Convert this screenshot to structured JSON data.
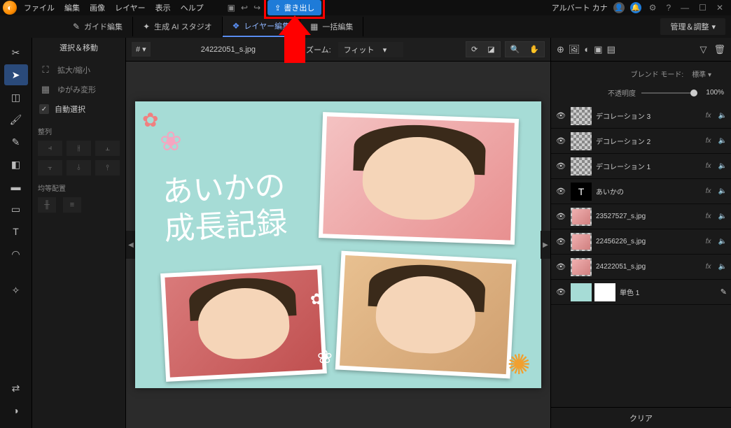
{
  "menu": {
    "file": "ファイル",
    "edit": "編集",
    "image": "画像",
    "layer": "レイヤー",
    "view": "表示",
    "help": "ヘルプ"
  },
  "toolbar": {
    "export": "書き出し",
    "user": "アルバート カナ"
  },
  "modes": {
    "guide": "ガイド編集",
    "ai": "生成 AI スタジオ",
    "layer": "レイヤー編集",
    "batch": "一括編集",
    "manage": "管理＆調整"
  },
  "options": {
    "title": "選択＆移動",
    "scale": "拡大/縮小",
    "warp": "ゆがみ変形",
    "autoselect": "自動選択",
    "align": "整列",
    "distribute": "均等配置"
  },
  "canvas": {
    "filename": "24222051_s.jpg",
    "zoom_label": "ズーム:",
    "zoom_value": "フィット",
    "text_line1": "あいかの",
    "text_line2": "成長記録"
  },
  "layerpanel": {
    "blend_label": "ブレンド モード:",
    "blend_value": "標準",
    "opacity_label": "不透明度",
    "opacity_value": "100%",
    "clear": "クリア",
    "fx": "fx"
  },
  "layers": [
    {
      "name": "デコレーション 3",
      "thumb": "checker",
      "fx": true
    },
    {
      "name": "デコレーション 2",
      "thumb": "checker",
      "fx": true
    },
    {
      "name": "デコレーション 1",
      "thumb": "checker",
      "fx": true
    },
    {
      "name": "あいかの",
      "thumb": "text",
      "fx": true
    },
    {
      "name": "23527527_s.jpg",
      "thumb": "photo",
      "fx": true
    },
    {
      "name": "22456226_s.jpg",
      "thumb": "photo",
      "fx": true
    },
    {
      "name": "24222051_s.jpg",
      "thumb": "photo",
      "fx": true
    },
    {
      "name": "単色 1",
      "thumb": "solid",
      "fx": false
    }
  ]
}
